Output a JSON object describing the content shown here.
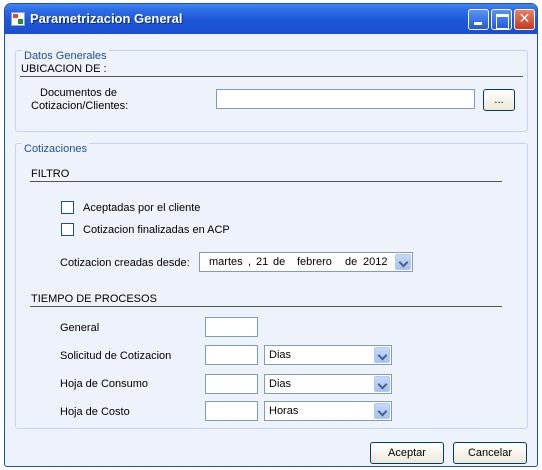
{
  "window": {
    "title": "Parametrizacion General"
  },
  "datos_generales": {
    "legend": "Datos Generales",
    "ubicacion_label": "UBICACION DE :",
    "documentos_label_line1": "Documentos de",
    "documentos_label_line2": "Cotizacion/Clientes:",
    "documentos_value": "",
    "browse_label": "..."
  },
  "cotizaciones": {
    "legend": "Cotizaciones",
    "filtro_label": "FILTRO",
    "aceptadas_label": "Aceptadas por el cliente",
    "aceptadas_checked": false,
    "finalizadas_label": "Cotizacion finalizadas en  ACP",
    "finalizadas_checked": false,
    "creadas_desde_label": "Cotizacion creadas desde:",
    "date": {
      "weekday": "martes",
      "sep": ",",
      "day": "21",
      "de1": "de",
      "month": "febrero",
      "de2": "de",
      "year": "2012"
    },
    "tiempo_label": "TIEMPO DE PROCESOS",
    "rows": [
      {
        "label": "General",
        "value": ""
      },
      {
        "label": "Solicitud de Cotizacion",
        "value": "",
        "unit": "Dias"
      },
      {
        "label": "Hoja de Consumo",
        "value": "",
        "unit": "Dias"
      },
      {
        "label": "Hoja de Costo",
        "value": "",
        "unit": "Horas"
      }
    ]
  },
  "footer": {
    "accept_label": "Aceptar",
    "cancel_label": "Cancelar"
  }
}
